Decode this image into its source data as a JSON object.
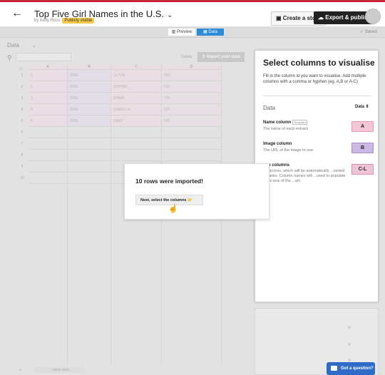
{
  "colors": {
    "accent_blue": "#2d8cd8",
    "topline_red": "#c7243a",
    "name_chip": "#f4c6d3",
    "image_chip": "#cbb9e3",
    "more_chip": "#efc3d6",
    "question_btn": "#2e6cc7"
  },
  "header": {
    "back_icon": "←",
    "title": "Top Five Girl Names in the U.S.",
    "title_chevron": "⌄",
    "byline": "by Kelly Ross",
    "visibility_badge": "Publicly visible",
    "create_story_icon": "▣",
    "create_story": "Create a story",
    "export_icon": "☁",
    "export_publish": "Export & publish"
  },
  "subbar": {
    "preview_icon": "▥",
    "preview": "Preview",
    "data_icon": "▦",
    "data": "Data",
    "saved": "✓ Saved"
  },
  "toolbar": {
    "data_select": "Data",
    "data_chevron": "⌄",
    "search_icon": "⚲",
    "details": "Details",
    "import_icon": "⇪",
    "import": "Import your data"
  },
  "grid": {
    "corner_icon": "⊡",
    "columns": [
      "A",
      "B",
      "C",
      "D"
    ],
    "row_numbers": [
      "1",
      "2",
      "3",
      "4",
      "5",
      "6",
      "7",
      "8",
      "9",
      "10"
    ],
    "rows": [
      [
        "1",
        "2016",
        "OLIVIA",
        "666"
      ],
      [
        "2",
        "2016",
        "SOPHIA",
        "615"
      ],
      [
        "3",
        "2016",
        "EMMA",
        "704"
      ],
      [
        "4",
        "2016",
        "ISABELLA",
        "626"
      ],
      [
        "5",
        "2016",
        "EMILY",
        "565"
      ]
    ],
    "add_row_icon": "+",
    "more_rows": "more rows"
  },
  "panel": {
    "title": "Select columns to visualise",
    "description": "Fill in the column id you want to visualise. Add multiple columns with a comma or hyphen (eg. A,B or A-C)",
    "data_label": "Data",
    "data_select": "Data ⇕",
    "columns": [
      {
        "name": "Name column",
        "required": "Required",
        "description": "The name of each entrant",
        "value": "A"
      },
      {
        "name": "Image column",
        "required": "",
        "description": "The URL of the image to use",
        "value": "B"
      },
      {
        "name": "...re columns",
        "required": "",
        "description": "...y scores, which will be automatically ...verted to ranks. Column names will ...used to populate the x-axis of the ...art.",
        "value": "C-L"
      }
    ]
  },
  "modal": {
    "title": "10 rows were imported!",
    "button": "Next, select the columns 👉",
    "cursor_icon": "☝"
  },
  "help": {
    "icon": "💬",
    "label": "Got a question?"
  }
}
